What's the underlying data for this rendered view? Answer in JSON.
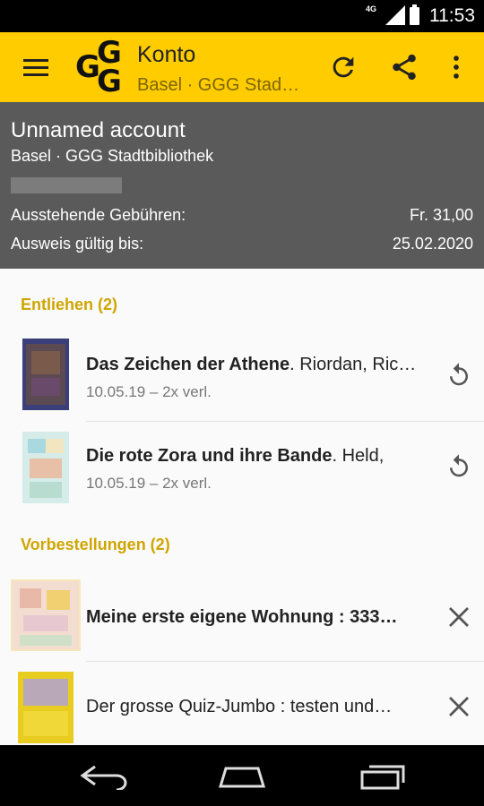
{
  "status_bar": {
    "time": "11:53",
    "network": "4G"
  },
  "app_bar": {
    "logo_letters": [
      "G",
      "G",
      "G"
    ],
    "title": "Konto",
    "subtitle": "Basel · GGG Stad…",
    "icons": [
      "menu-icon",
      "refresh-icon",
      "share-icon",
      "more-vert-icon"
    ]
  },
  "account": {
    "name": "Unnamed account",
    "library": "Basel · GGG Stadtbibliothek",
    "fees_label": "Ausstehende Gebühren:",
    "fees_value": "Fr. 31,00",
    "valid_label": "Ausweis gültig bis:",
    "valid_value": "25.02.2020"
  },
  "lent": {
    "header": "Entliehen (2)",
    "items": [
      {
        "title": "Das Zeichen der Athene",
        "author": ". Riordan, Ric…",
        "date": "10.05.19",
        "renewals": " – 2x verl."
      },
      {
        "title": "Die rote Zora und ihre Bande",
        "author": ". Held,",
        "date": "10.05.19",
        "renewals": " – 2x verl."
      }
    ]
  },
  "reservations": {
    "header": "Vorbestellungen (2)",
    "items": [
      {
        "title": "Meine erste eigene Wohnung : 333…"
      },
      {
        "title": "Der grosse Quiz-Jumbo : testen und…"
      }
    ]
  },
  "colors": {
    "accent": "#ffcc00",
    "header_bg": "#5a5a5a",
    "section_title": "#cfa500"
  }
}
